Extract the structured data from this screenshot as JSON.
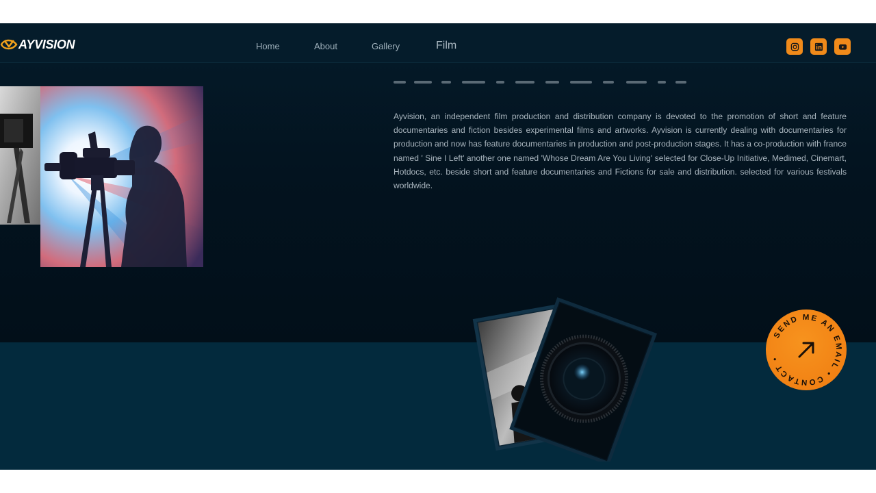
{
  "brand": {
    "name": "AYVISION",
    "accent": "#f08a1a"
  },
  "nav": {
    "items": [
      {
        "label": "Home"
      },
      {
        "label": "About"
      },
      {
        "label": "Gallery"
      },
      {
        "label": "Film",
        "active": true
      }
    ]
  },
  "socials": [
    {
      "icon": "instagram-icon"
    },
    {
      "icon": "linkedin-icon"
    },
    {
      "icon": "youtube-icon"
    }
  ],
  "about": {
    "description": "Ayvision, an independent film production and distribution company is devoted to the promotion of short and feature documentaries and fiction besides experimental films and artworks. Ayvision is currently dealing with documentaries for production and now has feature documentaries in production and post-production stages. It has a co-production with france named ' Sine I Left' another one named 'Whose Dream Are You Living' selected for Close-Up Initiative, Medimed, Cinemart, Hotdocs, etc. beside short and feature documentaries and Fictions for sale and distribution. selected for various festivals worldwide."
  },
  "contact": {
    "ring_text": "SEND ME AN EMAIL • CONTACT • "
  }
}
